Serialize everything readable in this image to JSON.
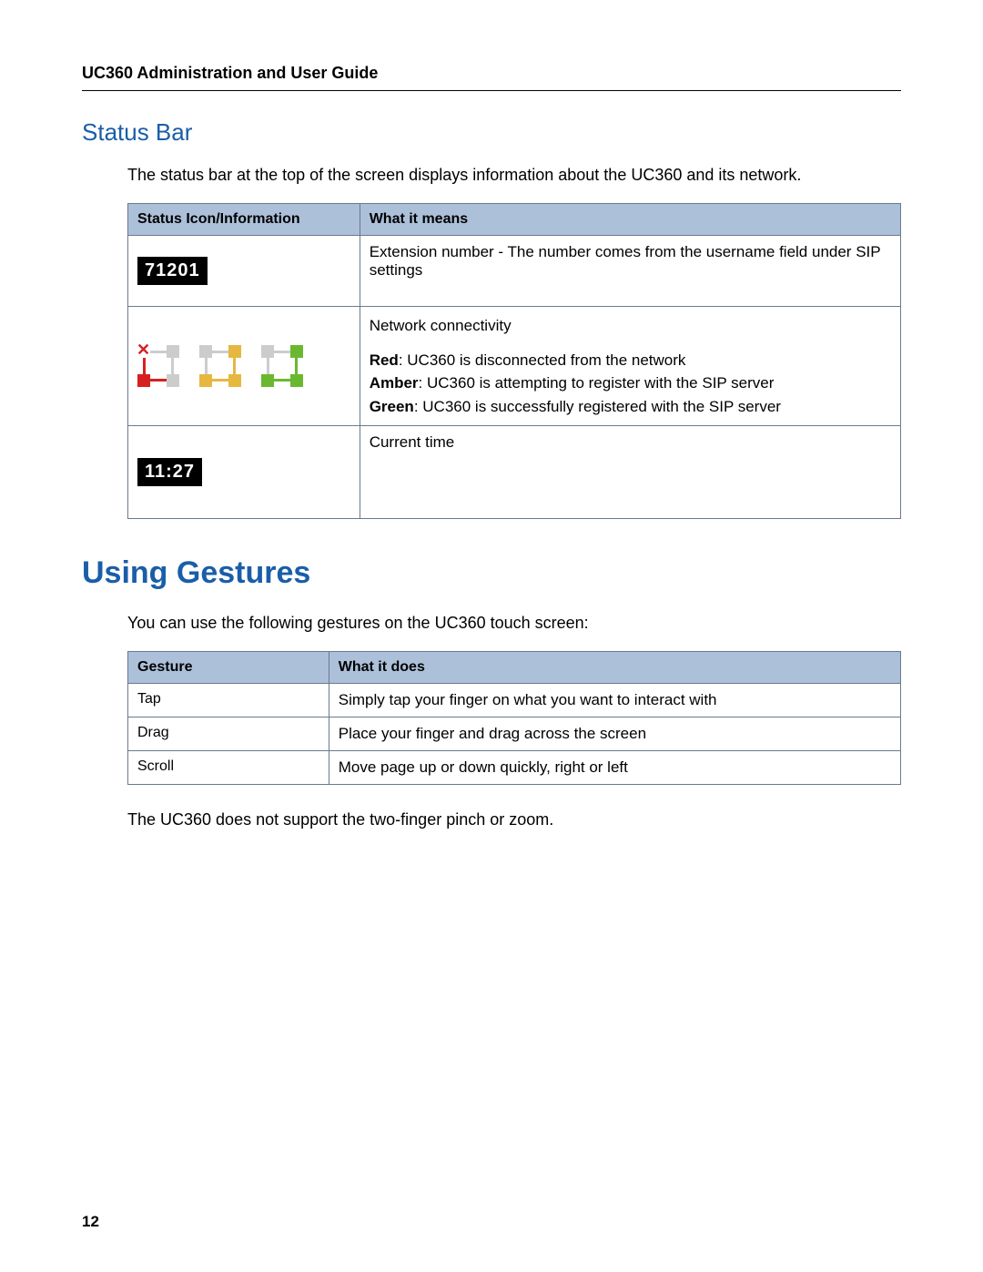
{
  "header": "UC360 Administration and User Guide",
  "section1": {
    "title": "Status Bar",
    "intro": "The status bar at the top of the screen displays information about the UC360 and its network."
  },
  "status_table": {
    "head": {
      "c1": "Status Icon/Information",
      "c2": "What it means"
    },
    "row1": {
      "icon_text": "71201",
      "desc": "Extension number - The number comes from the username field under SIP settings"
    },
    "row2": {
      "title": "Network connectivity",
      "red_label": "Red",
      "red_text": ": UC360 is disconnected from the network",
      "amber_label": "Amber",
      "amber_text": ": UC360 is attempting to register with the SIP server",
      "green_label": "Green",
      "green_text": ": UC360 is successfully registered with the SIP server"
    },
    "row3": {
      "icon_text": "11:27",
      "desc": "Current time"
    }
  },
  "section2": {
    "title": "Using Gestures",
    "intro": "You can use the following gestures on the UC360 touch screen:",
    "outro": "The UC360 does not support the two-finger pinch or zoom."
  },
  "gesture_table": {
    "head": {
      "c1": "Gesture",
      "c2": "What it does"
    },
    "rows": [
      {
        "g": "Tap",
        "d": "Simply tap your finger on what you want to interact with"
      },
      {
        "g": "Drag",
        "d": "Place your finger and drag across the screen"
      },
      {
        "g": "Scroll",
        "d": "Move page up or down quickly, right or left"
      }
    ]
  },
  "page_number": "12"
}
